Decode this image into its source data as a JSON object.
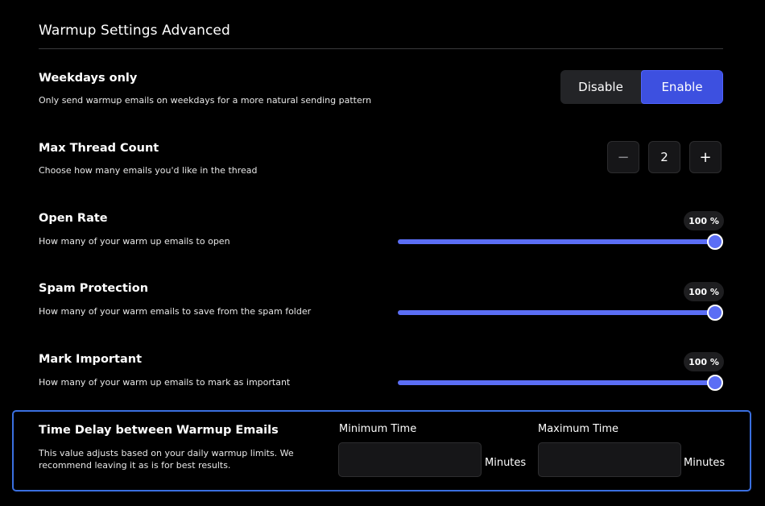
{
  "page": {
    "title": "Warmup Settings Advanced"
  },
  "weekdays": {
    "title": "Weekdays only",
    "description": "Only send warmup emails on weekdays for a more natural sending pattern",
    "options": [
      "Disable",
      "Enable"
    ],
    "selected": "Enable"
  },
  "thread": {
    "title": "Max Thread Count",
    "description": "Choose how many emails you'd like in the thread",
    "value": "2",
    "minus_symbol": "−",
    "plus_symbol": "+"
  },
  "sliders": [
    {
      "title": "Open Rate",
      "description": "How many of your warm up emails to open",
      "value_label": "100 %",
      "value": 100
    },
    {
      "title": "Spam Protection",
      "description": "How many of your warm emails to save from the spam folder",
      "value_label": "100 %",
      "value": 100
    },
    {
      "title": "Mark Important",
      "description": "How many of your warm up emails to mark as important",
      "value_label": "100 %",
      "value": 100
    }
  ],
  "time_delay": {
    "title": "Time Delay between Warmup Emails",
    "description_line1": "This value adjusts based on your daily warmup limits. We",
    "description_line2": "recommend leaving it as is for best results.",
    "min_label": "Minimum Time",
    "max_label": "Maximum Time",
    "min_value": "",
    "max_value": "",
    "unit": "Minutes"
  },
  "colors": {
    "accent": "#5b6ef5",
    "enable_active": "#3d50e0",
    "card_border": "#3a6fe0"
  }
}
